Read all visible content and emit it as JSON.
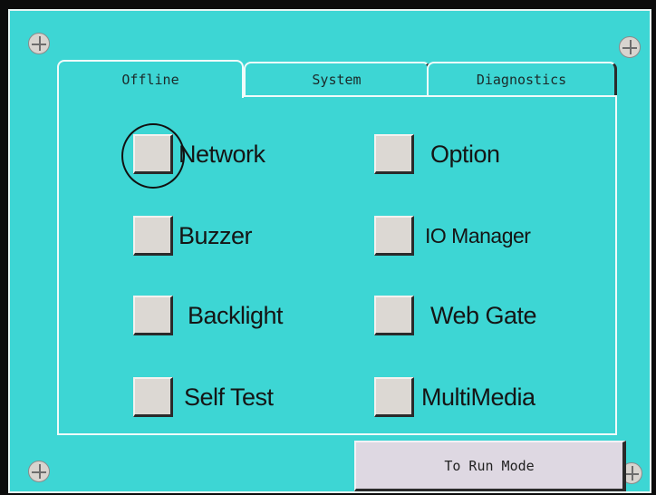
{
  "tabs": [
    {
      "label": "Offline",
      "active": true
    },
    {
      "label": "System",
      "active": false
    },
    {
      "label": "Diagnostics",
      "active": false
    }
  ],
  "options": [
    {
      "label": "Network",
      "checked": false
    },
    {
      "label": "Option",
      "checked": false
    },
    {
      "label": "Buzzer",
      "checked": false
    },
    {
      "label": "IO Manager",
      "checked": false
    },
    {
      "label": "Backlight",
      "checked": false
    },
    {
      "label": "Web Gate",
      "checked": false
    },
    {
      "label": "Self Test",
      "checked": false
    },
    {
      "label": "MultiMedia",
      "checked": false
    }
  ],
  "run_button": {
    "label": "To Run Mode"
  },
  "colors": {
    "screen_bg": "#3dd6d4",
    "button_face": "#dcd8d3",
    "run_button_face": "#ded8e2"
  }
}
